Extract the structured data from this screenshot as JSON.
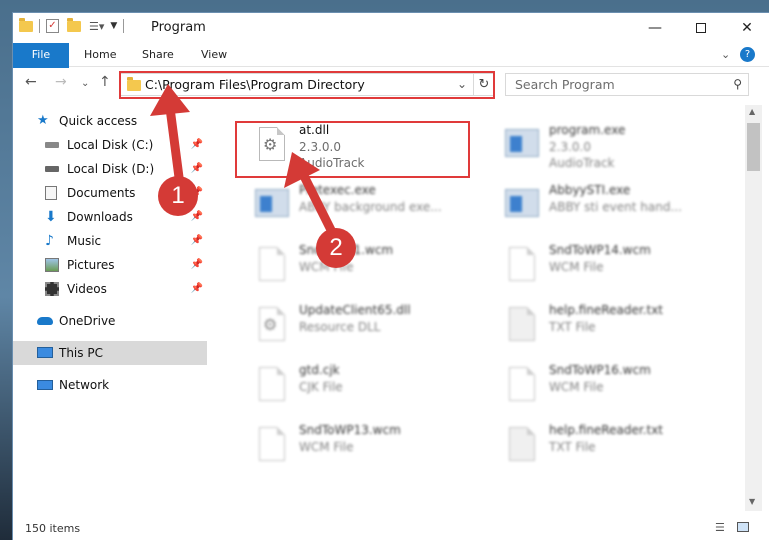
{
  "window": {
    "title": "Program"
  },
  "ribbon": {
    "tabs": [
      "File",
      "Home",
      "Share",
      "View"
    ]
  },
  "address": {
    "path": "C:\\Program Files\\Program Directory"
  },
  "search": {
    "placeholder": "Search Program"
  },
  "sidebar": {
    "items": [
      {
        "label": "Quick access",
        "icon": "star-icon"
      },
      {
        "label": "Local Disk (C:)",
        "icon": "drive-icon",
        "pinned": true
      },
      {
        "label": "Local Disk (D:)",
        "icon": "drive-icon",
        "pinned": true
      },
      {
        "label": "Documents",
        "icon": "documents-icon",
        "pinned": true
      },
      {
        "label": "Downloads",
        "icon": "download-icon",
        "pinned": true
      },
      {
        "label": "Music",
        "icon": "music-icon",
        "pinned": true
      },
      {
        "label": "Pictures",
        "icon": "pictures-icon",
        "pinned": true
      },
      {
        "label": "Videos",
        "icon": "videos-icon",
        "pinned": true
      },
      {
        "label": "OneDrive",
        "icon": "cloud-icon"
      },
      {
        "label": "This PC",
        "icon": "monitor-icon",
        "selected": true
      },
      {
        "label": "Network",
        "icon": "network-icon"
      }
    ]
  },
  "files": [
    {
      "name": "at.dll",
      "line2": "2.3.0.0",
      "line3": "AudioTrack",
      "icon": "dll-icon"
    },
    {
      "name": "program.exe",
      "line2": "2.3.0.0",
      "line3": "AudioTrack",
      "icon": "exe-icon"
    },
    {
      "name": "Pretexec.exe",
      "line2": "ABBY background exe...",
      "icon": "exe-icon"
    },
    {
      "name": "AbbyySTI.exe",
      "line2": "ABBY sti event hand...",
      "icon": "exe-icon"
    },
    {
      "name": "SndToWP1.wcm",
      "line2": "WCM File",
      "icon": "file-icon"
    },
    {
      "name": "SndToWP14.wcm",
      "line2": "WCM File",
      "icon": "file-icon"
    },
    {
      "name": "UpdateClient65.dll",
      "line2": "Resource DLL",
      "icon": "dll-icon"
    },
    {
      "name": "help.fineReader.txt",
      "line2": "TXT File",
      "icon": "file-icon"
    },
    {
      "name": "gtd.cjk",
      "line2": "CJK File",
      "icon": "file-icon"
    },
    {
      "name": "SndToWP16.wcm",
      "line2": "WCM File",
      "icon": "file-icon"
    },
    {
      "name": "SndToWP13.wcm",
      "line2": "WCM File",
      "icon": "file-icon"
    },
    {
      "name": "help.fineReader.txt",
      "line2": "TXT File",
      "icon": "file-icon"
    }
  ],
  "status": {
    "count": "150 items"
  },
  "annotations": {
    "step1": "1",
    "step2": "2",
    "color": "#d43a36"
  }
}
